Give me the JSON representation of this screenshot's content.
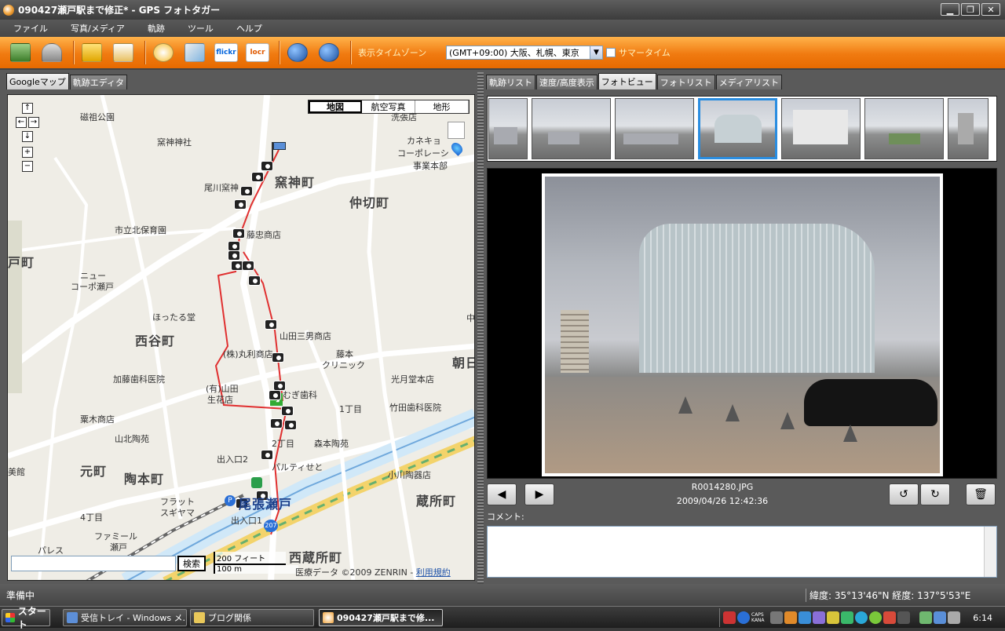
{
  "window": {
    "title": "090427瀬戸駅まで修正* - GPS フォトタガー"
  },
  "menu": [
    "ファイル",
    "写真/メディア",
    "軌跡",
    "ツール",
    "ヘルプ"
  ],
  "toolbar": {
    "flickr_label": "flickr",
    "locr_label": "locr",
    "timezone_label": "表示タイムゾーン",
    "timezone_value": "(GMT+09:00) 大阪、札幌、東京",
    "dst_label": "サマータイム"
  },
  "left_tabs": [
    "Googleマップ",
    "軌跡エディタ"
  ],
  "map": {
    "types": [
      "地図",
      "航空写真",
      "地形"
    ],
    "nav_buttons": [
      "↑",
      "←",
      "→",
      "↓",
      "+",
      "−"
    ],
    "labels": {
      "l1": "磁祖公園",
      "l2": "窯神神社",
      "l3": "窯神町",
      "l4": "尾川窯神",
      "l5": "仲切町",
      "l6": "市立北保育園",
      "l7": "藤忠商店",
      "l8": "ニュー",
      "l9": "コーポ瀬戸",
      "l10": "ほったる堂",
      "l11": "西谷町",
      "l12": "山田三男商店",
      "l13": "(株)丸利商店",
      "l14": "藤本",
      "l15": "クリニック",
      "l16": "加藤歯科医院",
      "l17": "(有)山田",
      "l18": "生花店",
      "l19": "むぎ歯科",
      "l20": "光月堂本店",
      "l21": "1丁目",
      "l22": "竹田歯科医院",
      "l23": "粟木商店",
      "l24": "山北陶苑",
      "l25": "2丁目",
      "l26": "森本陶苑",
      "l27": "元町",
      "l28": "陶本町",
      "l29": "出入口2",
      "l30": "パルティせと",
      "l31": "小川陶器店",
      "l32": "蔵所町",
      "l33": "フラット",
      "l34": "スギヤマ",
      "l35": "尾張瀬戸",
      "l36": "4丁目",
      "l37": "出入口1",
      "l38": "ファミール",
      "l39": "瀬戸",
      "l40": "パレス",
      "l41": "西蔵所町",
      "l42": "朝日",
      "l43": "カネキョ",
      "l44": "コーポレーシ",
      "l45": "事業本部",
      "l46": "洗張店",
      "l47": "戸町",
      "l48": "中",
      "l49": "美館",
      "l50": "207"
    },
    "search_button": "検索",
    "scale_ft": "200 フィート",
    "scale_m": "100 m",
    "copyright": "医療データ ©2009 ZENRIN -",
    "terms": "利用規約"
  },
  "right_tabs": [
    "軌跡リスト",
    "速度/高度表示",
    "フォトビュー",
    "フォトリスト",
    "メディアリスト"
  ],
  "photo": {
    "filename": "R0014280.JPG",
    "datetime": "2009/04/26 12:42:36",
    "comment_label": "コメント:"
  },
  "status": {
    "left": "準備中",
    "right": "緯度: 35°13'46\"N  経度: 137°5'53\"E"
  },
  "taskbar": {
    "start": "スタート",
    "tasks": [
      "受信トレイ - Windows メ...",
      "ブログ関係",
      "090427瀬戸駅まで修..."
    ],
    "clock": "6:14",
    "caps": "CAPS",
    "kana": "KANA"
  },
  "colors": {
    "accent": "#f07a10",
    "track": "#e03030",
    "selection": "#2a8de0"
  }
}
